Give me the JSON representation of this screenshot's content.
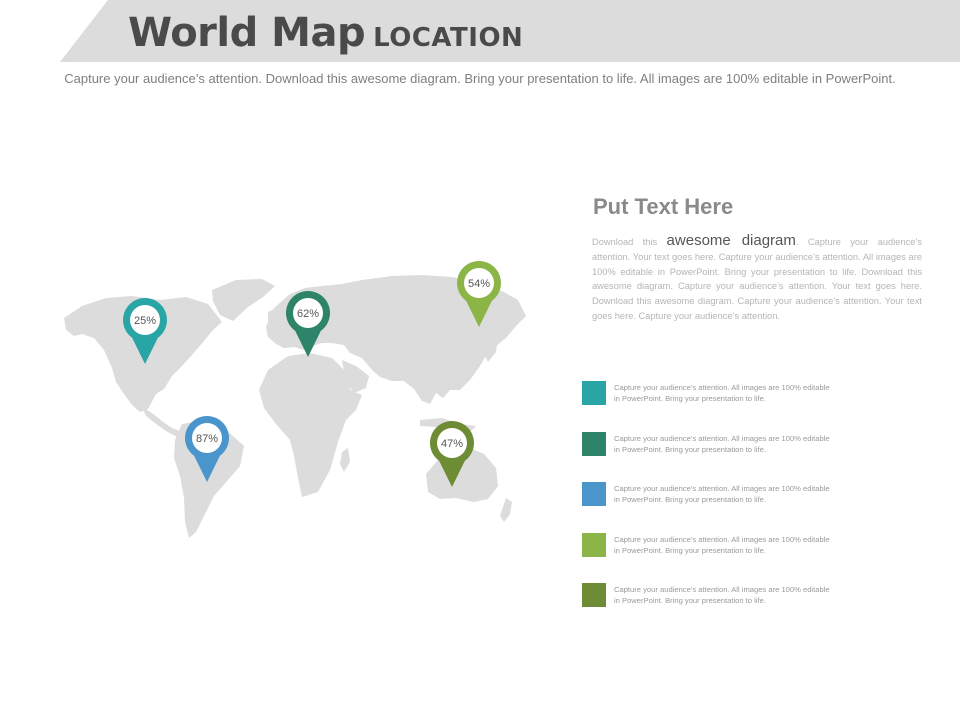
{
  "header": {
    "title_main": "World Map",
    "title_sub": "LOCATION",
    "subtitle": "Capture your audience’s attention. Download this  awesome diagram. Bring your presentation to life. All images are 100% editable in PowerPoint."
  },
  "map": {
    "continent_color": "#dcdcdc",
    "pins": [
      {
        "id": "north-america",
        "label": "25%",
        "color": "#2aa5a5"
      },
      {
        "id": "europe",
        "label": "62%",
        "color": "#2e8468"
      },
      {
        "id": "asia",
        "label": "54%",
        "color": "#8cb547"
      },
      {
        "id": "south-america",
        "label": "87%",
        "color": "#4a95cc"
      },
      {
        "id": "australia",
        "label": "47%",
        "color": "#6e8b35"
      }
    ]
  },
  "panel": {
    "heading": "Put Text Here",
    "body_lead": "Download this ",
    "body_emphasis": "awesome diagram",
    "body_rest": ". Capture your audience’s attention. Your text goes here. Capture your audience’s attention. All images are 100% editable in PowerPoint. Bring your presentation to life. Download this awesome diagram. Capture your audience’s attention. Your text goes here. Download this awesome diagram. Capture your audience’s attention. Your text goes here. Capture your audience’s attention."
  },
  "legend": [
    {
      "color": "#2aa5a5",
      "text": "Capture your audience’s attention. All images are 100% editable in PowerPoint. Bring your presentation to life."
    },
    {
      "color": "#2e8468",
      "text": "Capture your audience’s attention. All images are 100% editable in PowerPoint. Bring your presentation to life."
    },
    {
      "color": "#4a95cc",
      "text": "Capture your audience’s attention. All images are 100% editable in PowerPoint. Bring your presentation to life."
    },
    {
      "color": "#8cb547",
      "text": "Capture your audience’s attention. All images are 100% editable in PowerPoint. Bring your presentation to life."
    },
    {
      "color": "#6e8b35",
      "text": "Capture your audience’s attention. All images are 100% editable in PowerPoint. Bring your presentation to life."
    }
  ]
}
